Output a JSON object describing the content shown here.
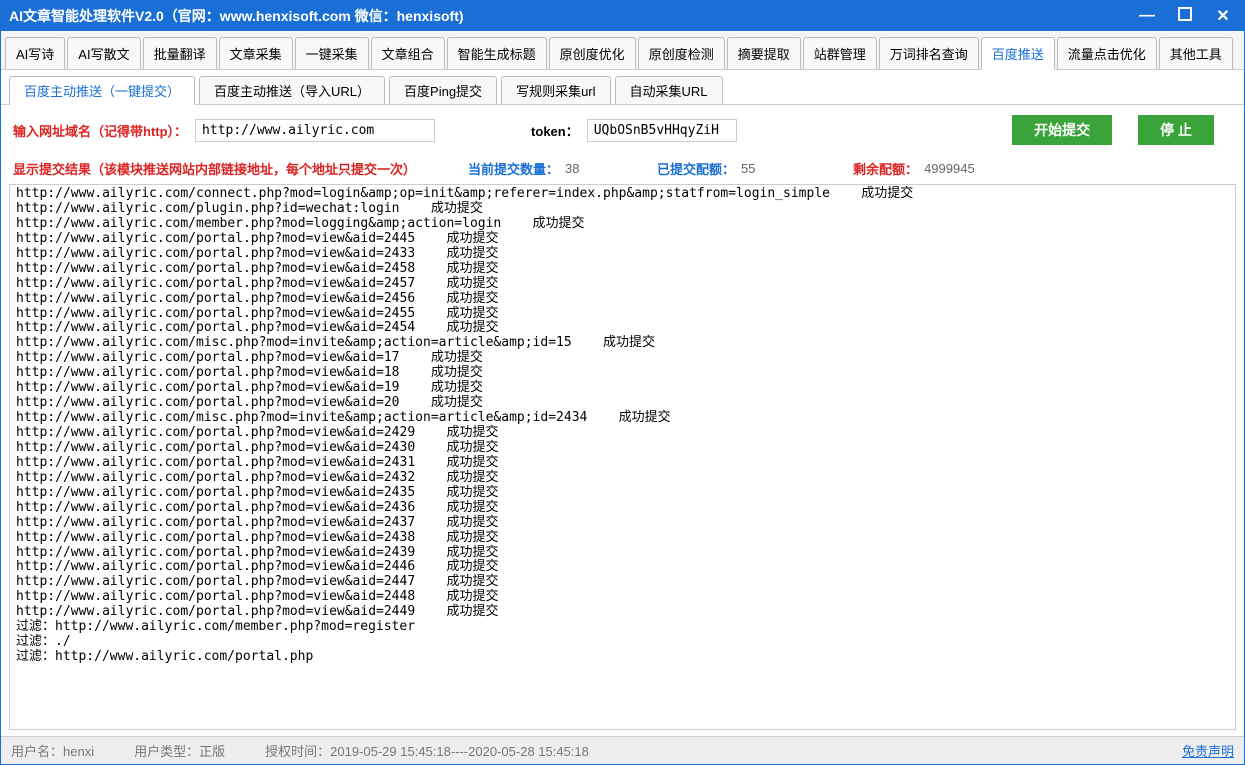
{
  "window": {
    "title": "AI文章智能处理软件V2.0（官网：www.henxisoft.com  微信：henxisoft)"
  },
  "mainTabs": [
    "AI写诗",
    "AI写散文",
    "批量翻译",
    "文章采集",
    "一键采集",
    "文章组合",
    "智能生成标题",
    "原创度优化",
    "原创度检测",
    "摘要提取",
    "站群管理",
    "万词排名查询",
    "百度推送",
    "流量点击优化",
    "其他工具"
  ],
  "mainTabActive": 12,
  "subTabs": [
    "百度主动推送（一键提交）",
    "百度主动推送（导入URL）",
    "百度Ping提交",
    "写规则采集url",
    "自动采集URL"
  ],
  "subTabActive": 0,
  "inputRow": {
    "urlLabel": "输入网址域名（记得带http）：",
    "urlValue": "http://www.ailyric.com",
    "tokenLabel": "token：",
    "tokenValue": "UQbOSnB5vHHqyZiH",
    "startBtn": "开始提交",
    "stopBtn": "停 止"
  },
  "statsRow": {
    "resultLabel": "显示提交结果（该模块推送网站内部链接地址，每个地址只提交一次）",
    "currentLabel": "当前提交数量：",
    "currentValue": "38",
    "submittedLabel": "已提交配额：",
    "submittedValue": "55",
    "remainLabel": "剩余配额：",
    "remainValue": "4999945"
  },
  "logLines": [
    "http://www.ailyric.com/connect.php?mod=login&amp;op=init&amp;referer=index.php&amp;statfrom=login_simple    成功提交",
    "http://www.ailyric.com/plugin.php?id=wechat:login    成功提交",
    "http://www.ailyric.com/member.php?mod=logging&amp;action=login    成功提交",
    "http://www.ailyric.com/portal.php?mod=view&aid=2445    成功提交",
    "http://www.ailyric.com/portal.php?mod=view&aid=2433    成功提交",
    "http://www.ailyric.com/portal.php?mod=view&aid=2458    成功提交",
    "http://www.ailyric.com/portal.php?mod=view&aid=2457    成功提交",
    "http://www.ailyric.com/portal.php?mod=view&aid=2456    成功提交",
    "http://www.ailyric.com/portal.php?mod=view&aid=2455    成功提交",
    "http://www.ailyric.com/portal.php?mod=view&aid=2454    成功提交",
    "http://www.ailyric.com/misc.php?mod=invite&amp;action=article&amp;id=15    成功提交",
    "http://www.ailyric.com/portal.php?mod=view&aid=17    成功提交",
    "http://www.ailyric.com/portal.php?mod=view&aid=18    成功提交",
    "http://www.ailyric.com/portal.php?mod=view&aid=19    成功提交",
    "http://www.ailyric.com/portal.php?mod=view&aid=20    成功提交",
    "http://www.ailyric.com/misc.php?mod=invite&amp;action=article&amp;id=2434    成功提交",
    "http://www.ailyric.com/portal.php?mod=view&aid=2429    成功提交",
    "http://www.ailyric.com/portal.php?mod=view&aid=2430    成功提交",
    "http://www.ailyric.com/portal.php?mod=view&aid=2431    成功提交",
    "http://www.ailyric.com/portal.php?mod=view&aid=2432    成功提交",
    "http://www.ailyric.com/portal.php?mod=view&aid=2435    成功提交",
    "http://www.ailyric.com/portal.php?mod=view&aid=2436    成功提交",
    "http://www.ailyric.com/portal.php?mod=view&aid=2437    成功提交",
    "http://www.ailyric.com/portal.php?mod=view&aid=2438    成功提交",
    "http://www.ailyric.com/portal.php?mod=view&aid=2439    成功提交",
    "http://www.ailyric.com/portal.php?mod=view&aid=2446    成功提交",
    "http://www.ailyric.com/portal.php?mod=view&aid=2447    成功提交",
    "http://www.ailyric.com/portal.php?mod=view&aid=2448    成功提交",
    "http://www.ailyric.com/portal.php?mod=view&aid=2449    成功提交",
    "",
    "过滤：http://www.ailyric.com/member.php?mod=register",
    "过滤：./",
    "过滤：http://www.ailyric.com/portal.php"
  ],
  "statusbar": {
    "userLabel": "用户名：",
    "userValue": "henxi",
    "typeLabel": "用户类型：",
    "typeValue": "正版",
    "authLabel": "授权时间：",
    "authValue": "2019-05-29 15:45:18----2020-05-28 15:45:18",
    "disclaimer": "免责声明"
  }
}
